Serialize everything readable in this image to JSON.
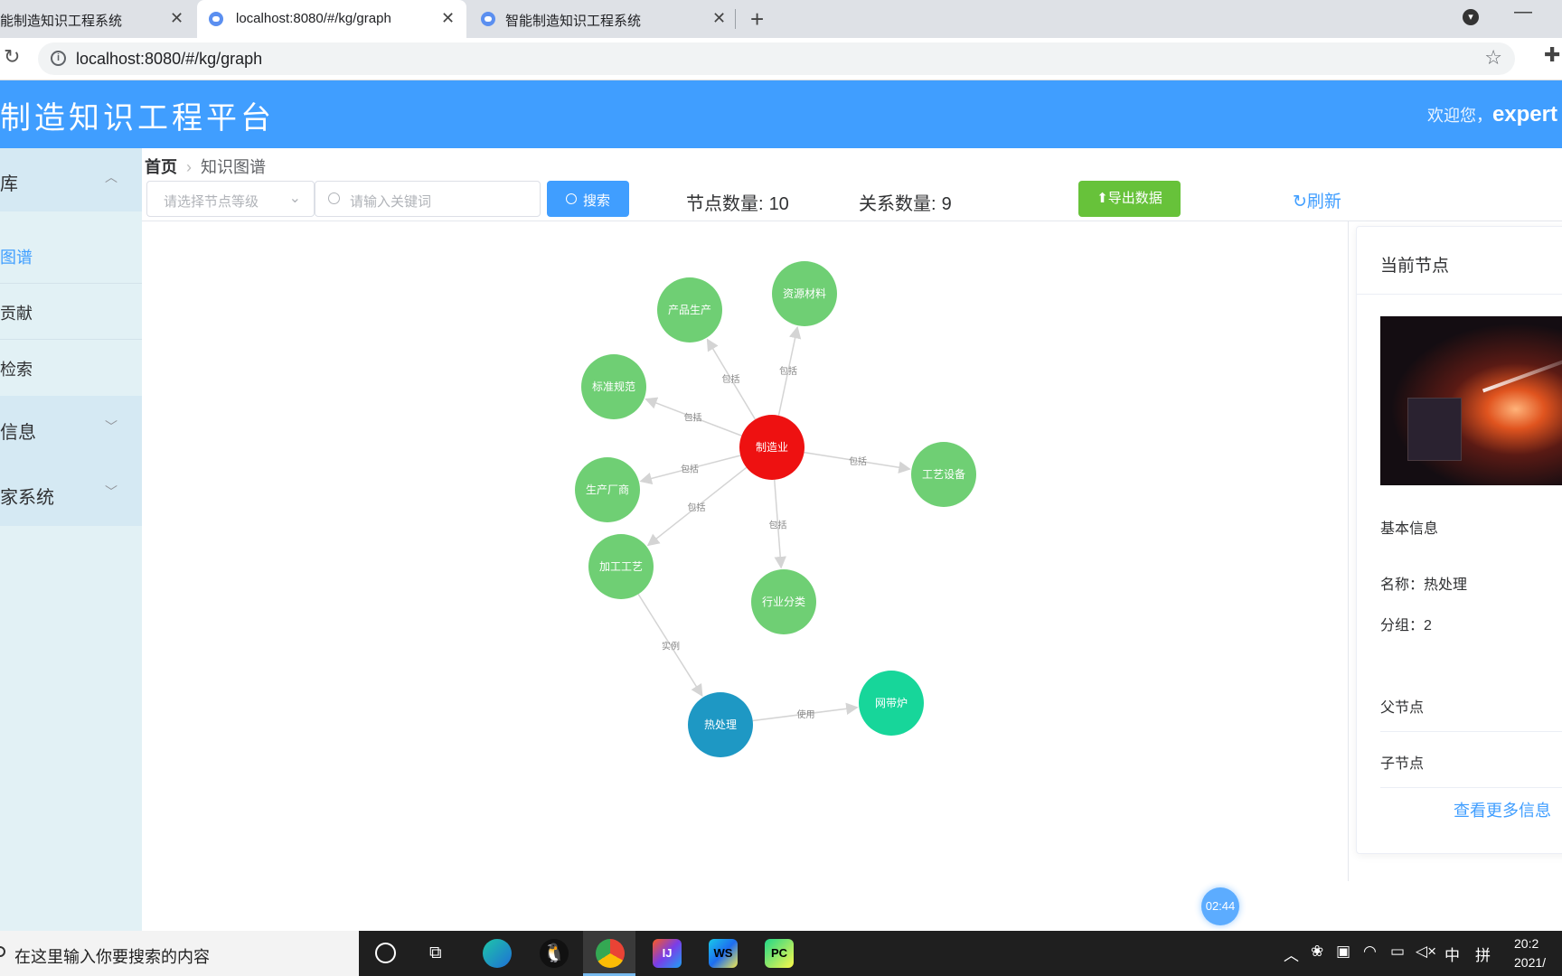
{
  "browser": {
    "tabs": [
      {
        "title": "能制造知识工程系统",
        "active": false
      },
      {
        "title": "localhost:8080/#/kg/graph",
        "active": true
      },
      {
        "title": "智能制造知识工程系统",
        "active": false
      }
    ],
    "url": "localhost:8080/#/kg/graph"
  },
  "header": {
    "title": "制造知识工程平台",
    "greeting": "欢迎您，",
    "user": "expert"
  },
  "sidebar": {
    "groups": [
      {
        "label": "库",
        "chevron": "up"
      },
      {
        "label": "信息",
        "chevron": "down"
      },
      {
        "label": "家系统",
        "chevron": "down"
      }
    ],
    "items": [
      {
        "label": "图谱",
        "active": true
      },
      {
        "label": "贡献",
        "active": false
      },
      {
        "label": "检索",
        "active": false
      }
    ]
  },
  "breadcrumb": {
    "home": "首页",
    "current": "知识图谱"
  },
  "toolbar": {
    "level_placeholder": "请选择节点等级",
    "keyword_placeholder": "请输入关键词",
    "search_label": "搜索",
    "node_count_label": "节点数量:",
    "node_count": "10",
    "relation_count_label": "关系数量:",
    "relation_count": "9",
    "export_label": "导出数据",
    "refresh_label": "刷新"
  },
  "graph": {
    "nodes": [
      {
        "id": "center",
        "label": "制造业",
        "color": "#ee1111"
      },
      {
        "id": "n1",
        "label": "产品生产",
        "color": "#6fcf74"
      },
      {
        "id": "n2",
        "label": "资源材料",
        "color": "#6fcf74"
      },
      {
        "id": "n3",
        "label": "标准规范",
        "color": "#6fcf74"
      },
      {
        "id": "n4",
        "label": "工艺设备",
        "color": "#6fcf74"
      },
      {
        "id": "n5",
        "label": "生产厂商",
        "color": "#6fcf74"
      },
      {
        "id": "n6",
        "label": "加工工艺",
        "color": "#6fcf74"
      },
      {
        "id": "n7",
        "label": "行业分类",
        "color": "#6fcf74"
      },
      {
        "id": "n8",
        "label": "热处理",
        "color": "#1e98c4"
      },
      {
        "id": "n9",
        "label": "网带炉",
        "color": "#17d69a"
      }
    ],
    "edges": [
      {
        "from": "center",
        "to": "n1",
        "label": "包括"
      },
      {
        "from": "center",
        "to": "n2",
        "label": "包括"
      },
      {
        "from": "center",
        "to": "n3",
        "label": "包括"
      },
      {
        "from": "center",
        "to": "n4",
        "label": "包括"
      },
      {
        "from": "center",
        "to": "n5",
        "label": "包括"
      },
      {
        "from": "center",
        "to": "n6",
        "label": "包括"
      },
      {
        "from": "center",
        "to": "n7",
        "label": "包括"
      },
      {
        "from": "n6",
        "to": "n8",
        "label": "实例"
      },
      {
        "from": "n8",
        "to": "n9",
        "label": "使用"
      }
    ]
  },
  "panel": {
    "title": "当前节点",
    "basic_info": "基本信息",
    "name": "名称：热处理",
    "group": "分组：2",
    "parent": "父节点",
    "child": "子节点",
    "more": "查看更多信息"
  },
  "timer": "02:44",
  "taskbar": {
    "search_text": "在这里输入你要搜索的内容",
    "tray_lang": "中",
    "tray_ime": "拼",
    "time": "20:2",
    "date": "2021/"
  }
}
